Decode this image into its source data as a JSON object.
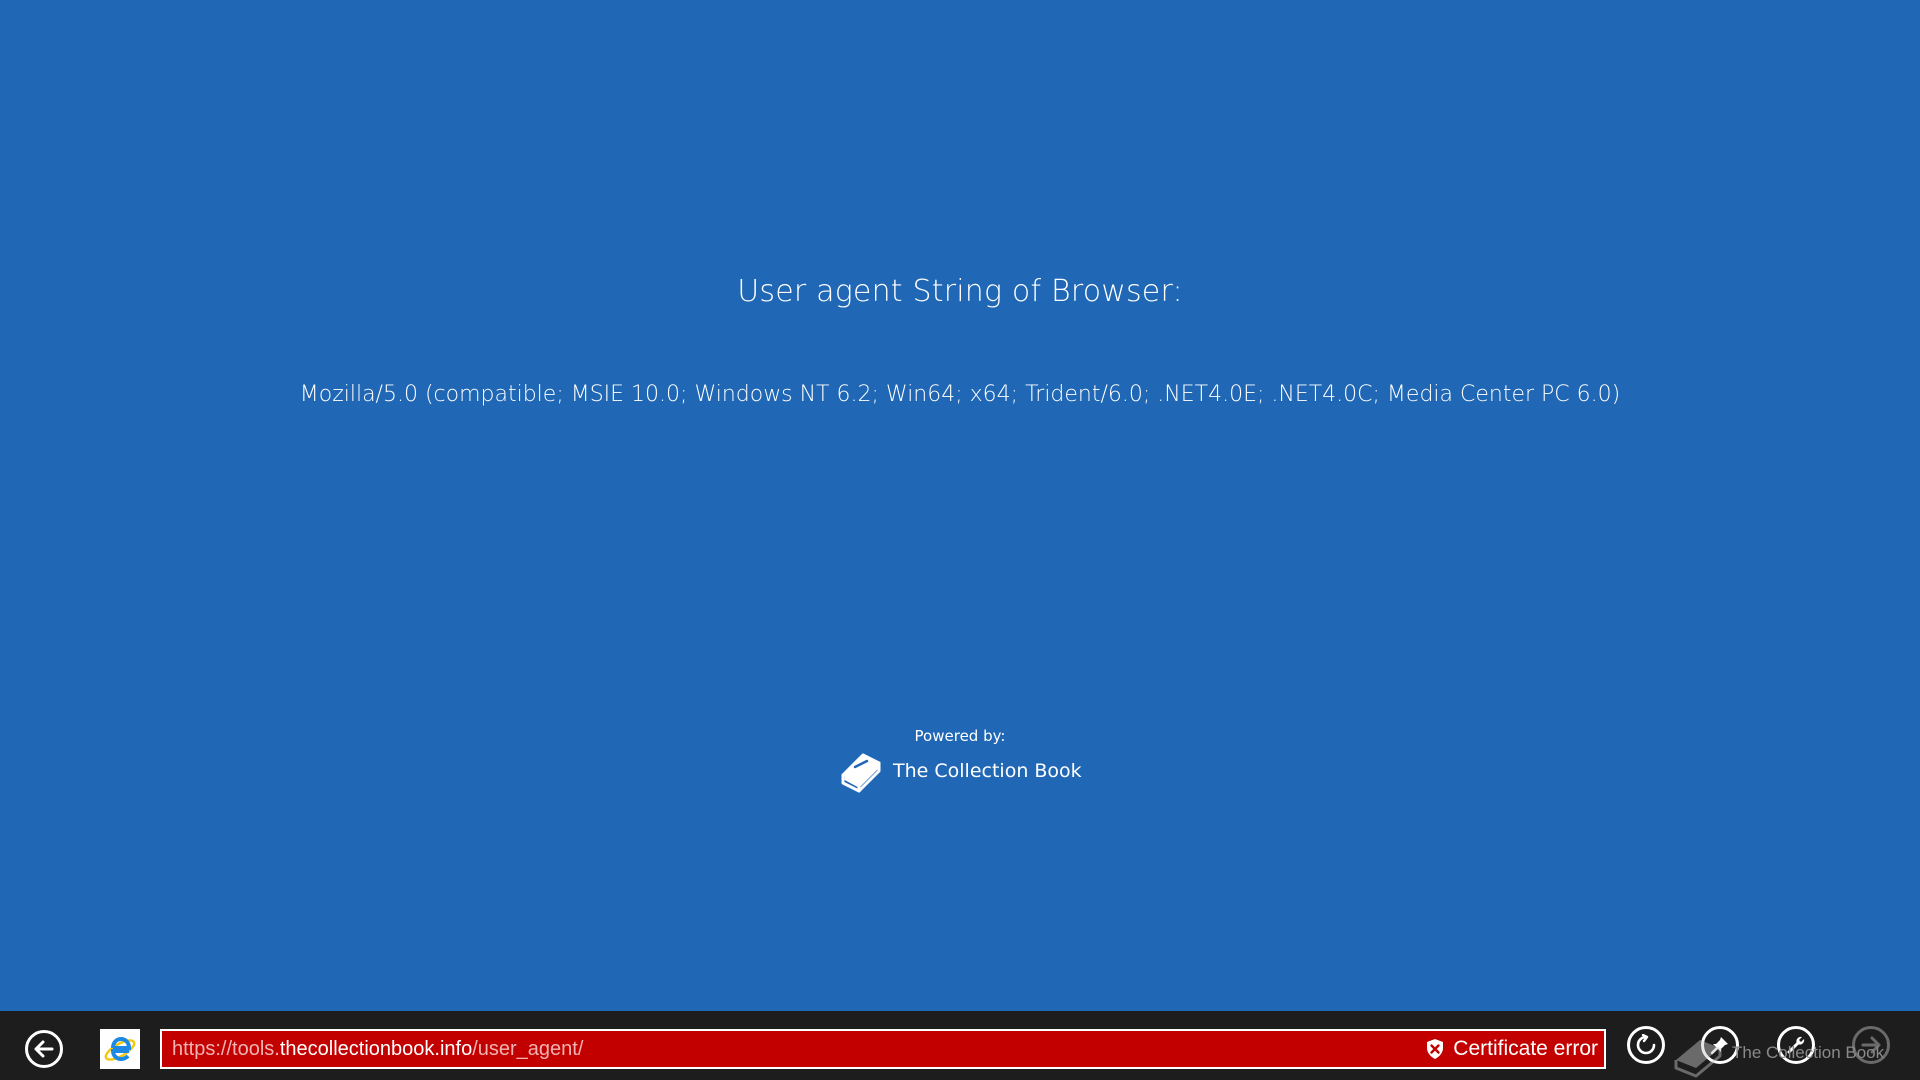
{
  "page": {
    "heading": "User agent String of Browser:",
    "user_agent": "Mozilla/5.0 (compatible; MSIE 10.0; Windows NT 6.2; Win64; x64; Trident/6.0; .NET4.0E; .NET4.0C; Media Center PC 6.0)",
    "powered_by_label": "Powered by:",
    "brand_name": "The Collection Book",
    "background_color": "#2067b5"
  },
  "appbar": {
    "url_prefix": "https://tools.",
    "url_host": "thecollectionbook.info",
    "url_suffix": "/user_agent/",
    "certificate_status": "Certificate error",
    "drag_tooltip": "The Collection Book",
    "address_bar_color": "#c20000",
    "icons": {
      "back": "back-arrow-icon",
      "site": "internet-explorer-icon",
      "certificate": "shield-x-icon",
      "refresh": "refresh-icon",
      "pin": "pin-icon",
      "tools": "wrench-icon",
      "forward": "forward-arrow-icon"
    }
  }
}
